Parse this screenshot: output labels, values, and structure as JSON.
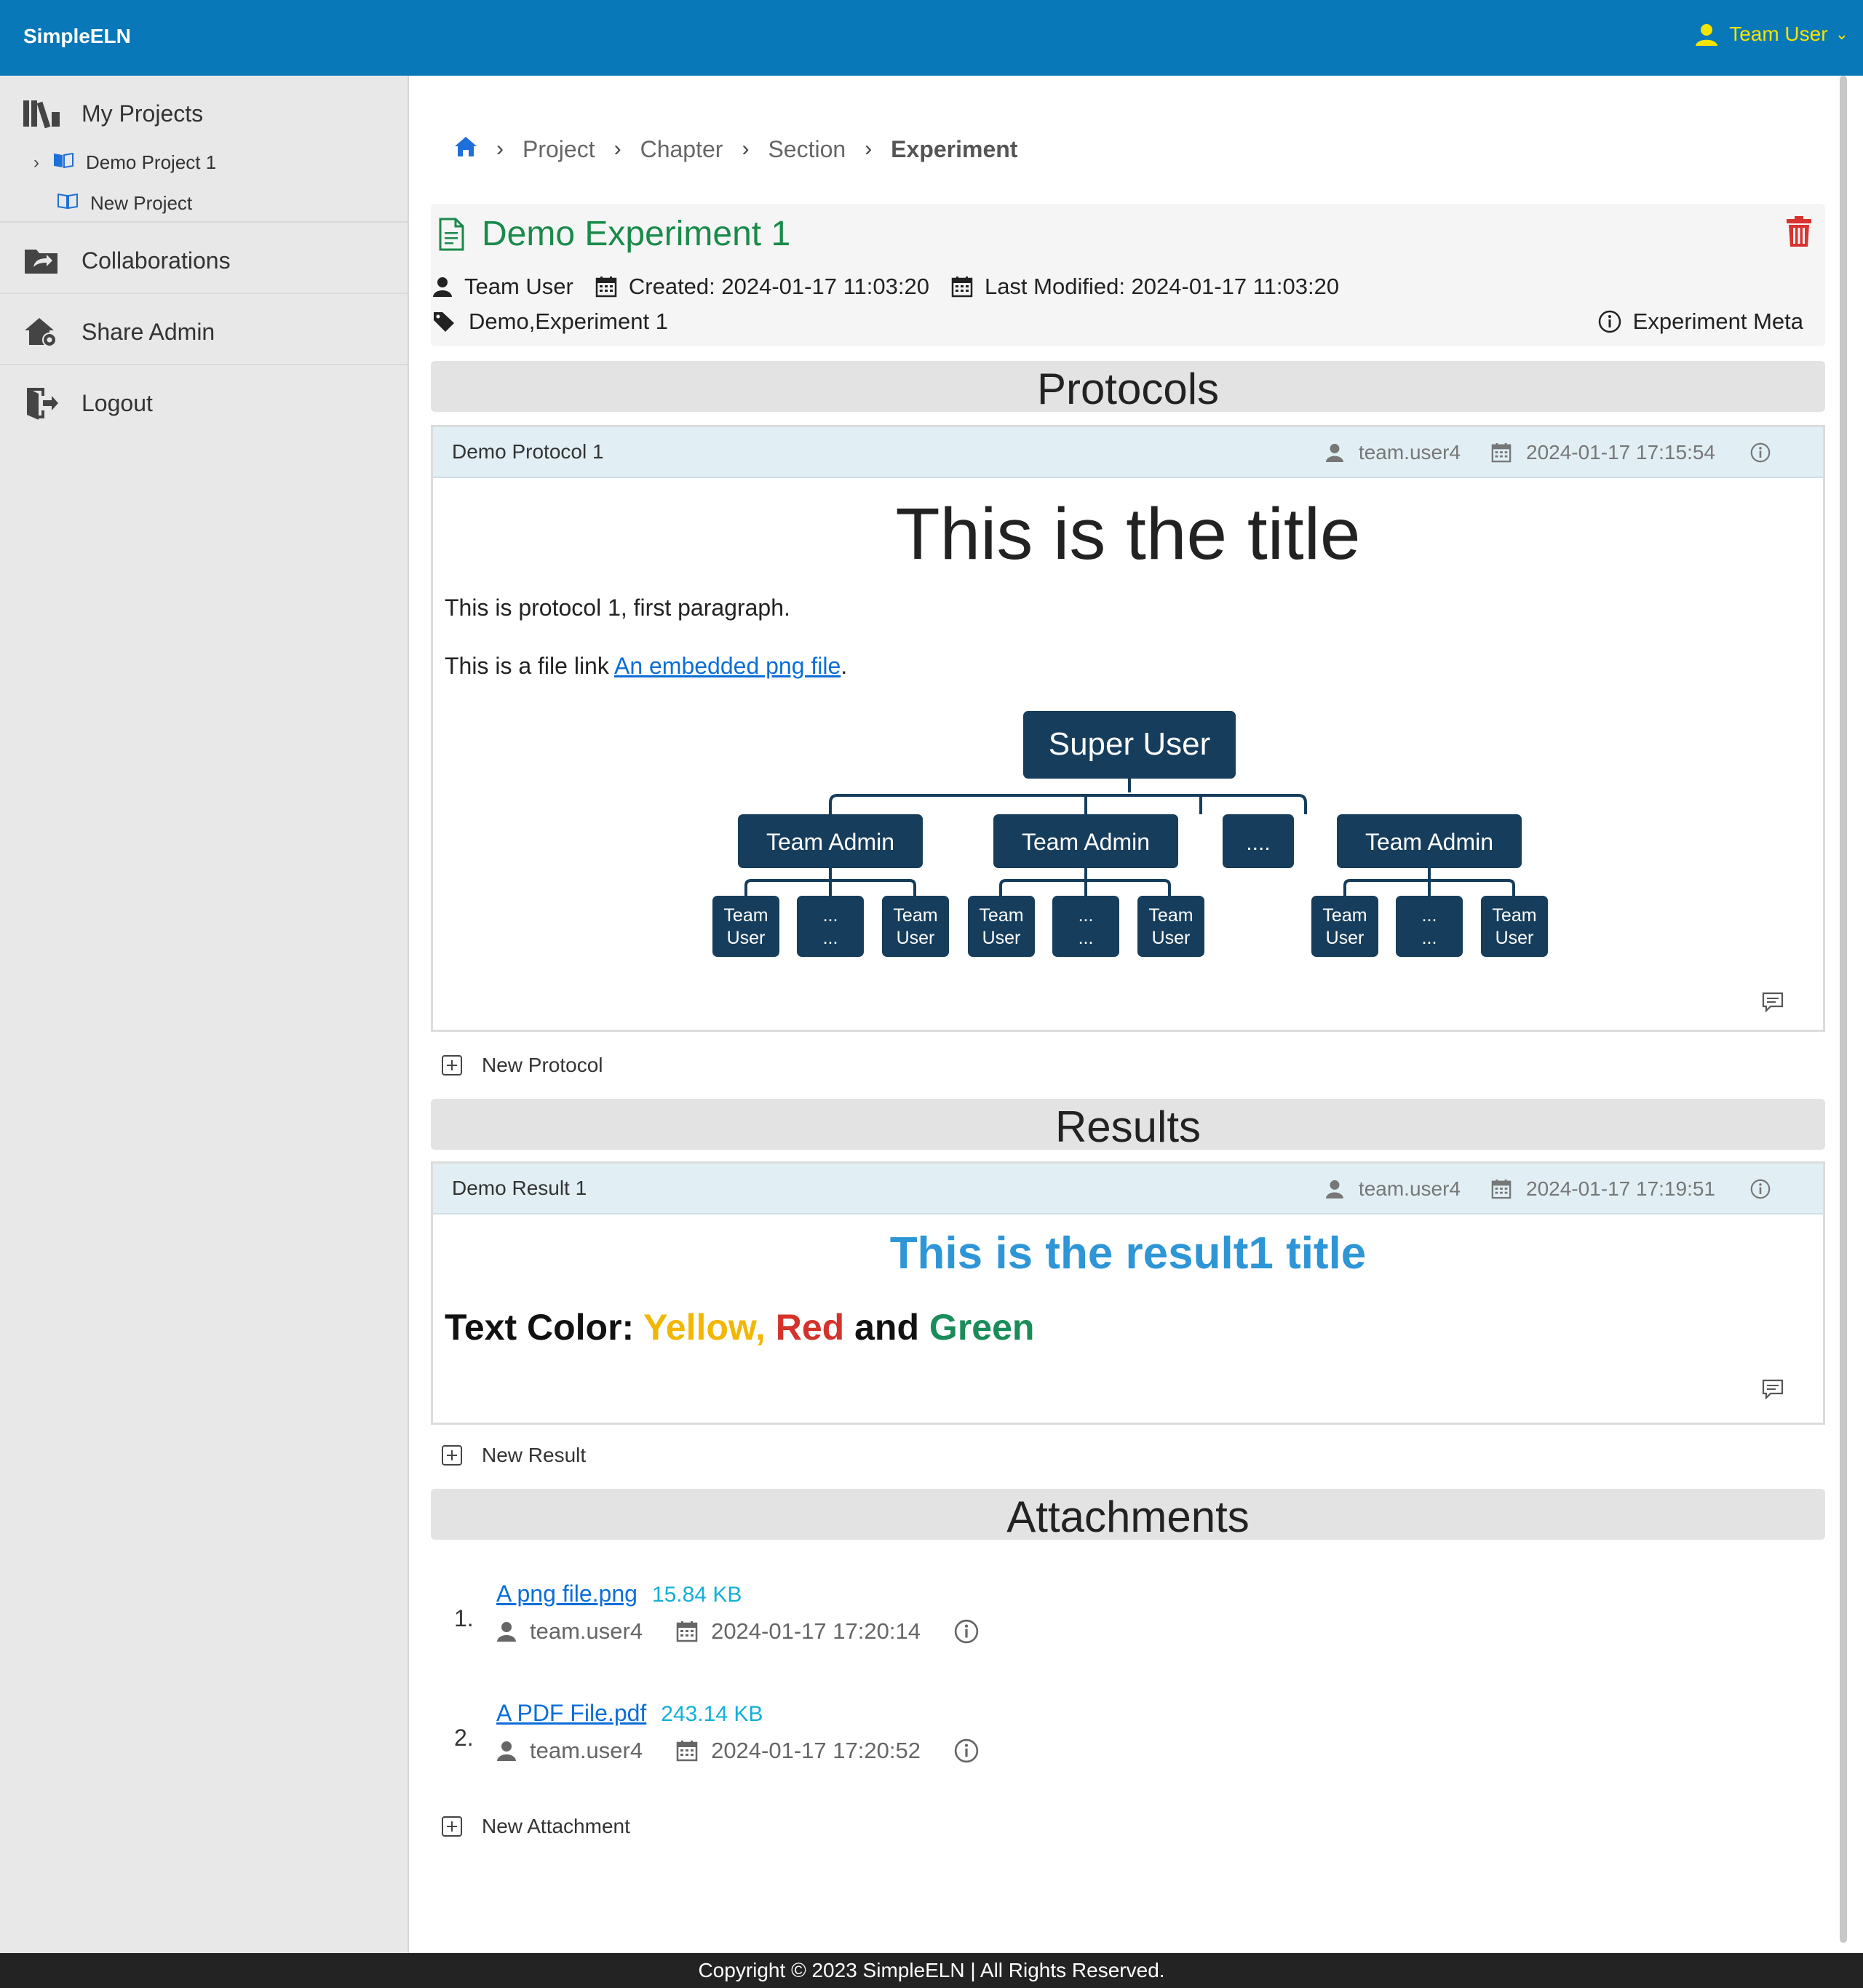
{
  "app": {
    "brand": "SimpleELN",
    "user": "Team User"
  },
  "sidebar": {
    "my_projects": "My Projects",
    "projects": [
      "Demo Project 1",
      "New Project"
    ],
    "collaborations": "Collaborations",
    "share_admin": "Share Admin",
    "logout": "Logout"
  },
  "breadcrumb": {
    "project": "Project",
    "chapter": "Chapter",
    "section": "Section",
    "current": "Experiment"
  },
  "experiment": {
    "title": "Demo Experiment 1",
    "owner": "Team User",
    "created": "Created: 2024-01-17 11:03:20",
    "modified": "Last Modified: 2024-01-17 11:03:20",
    "tags": "Demo,Experiment 1",
    "meta_link": "Experiment Meta"
  },
  "protocols": {
    "heading": "Protocols",
    "item": {
      "name": "Demo Protocol 1",
      "user": "team.user4",
      "date": "2024-01-17 17:15:54",
      "title": "This is the title",
      "para1": "This is protocol 1, first paragraph.",
      "para2_prefix": "This is a file link ",
      "para2_link": "An embedded png file",
      "para2_suffix": "."
    },
    "add": "New Protocol"
  },
  "org_chart": {
    "root": "Super User",
    "admin": "Team Admin",
    "ellipsis": "....",
    "user_line1": "Team",
    "user_line2": "User",
    "dots": "..."
  },
  "results": {
    "heading": "Results",
    "item": {
      "name": "Demo Result 1",
      "user": "team.user4",
      "date": "2024-01-17 17:19:51",
      "title": "This is the result1 title",
      "text_prefix": "Text Color: ",
      "yellow": "Yellow,",
      "red": "Red",
      "and": "and",
      "green": "Green"
    },
    "add": "New Result"
  },
  "attachments": {
    "heading": "Attachments",
    "items": [
      {
        "num": "1.",
        "name": "A png file.png",
        "size": "15.84 KB",
        "user": "team.user4",
        "date": "2024-01-17 17:20:14"
      },
      {
        "num": "2.",
        "name": "A PDF File.pdf",
        "size": "243.14 KB",
        "user": "team.user4",
        "date": "2024-01-17 17:20:52"
      }
    ],
    "add": "New Attachment"
  },
  "footer": "Copyright © 2023 SimpleELN | All Rights Reserved.",
  "colors": {
    "topbar": "#0878b8",
    "user_accent": "#f5e300",
    "title_green": "#1a8a4a",
    "trash_red": "#d9322f",
    "node_navy": "#163d5c"
  }
}
